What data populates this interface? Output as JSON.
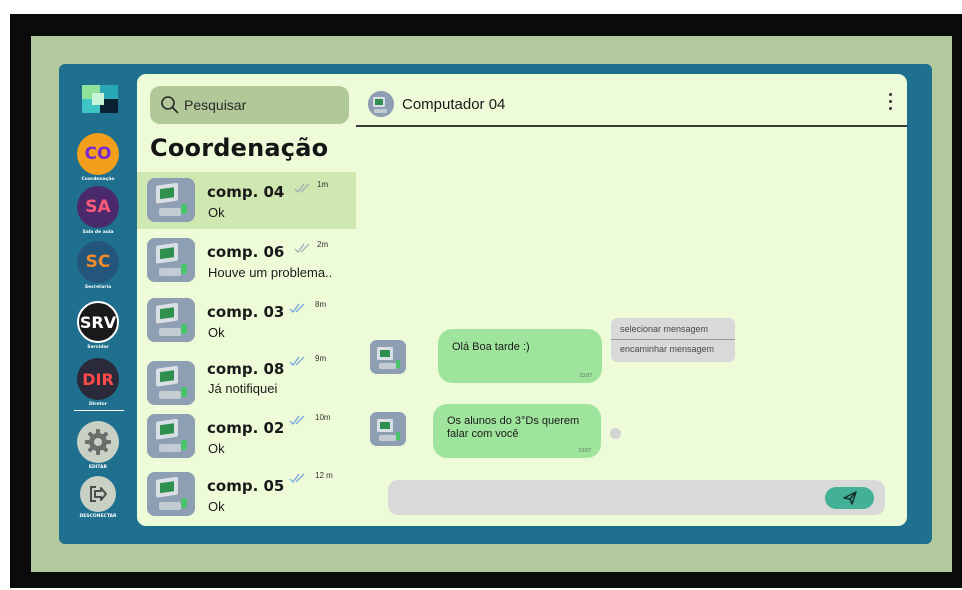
{
  "rail": {
    "items": [
      {
        "initials": "CO",
        "label": "Coordenação",
        "bg": "#f2a01c",
        "fg": "#7a2ad0"
      },
      {
        "initials": "SA",
        "label": "Sala de aula",
        "bg": "#4a2a6a",
        "fg": "#ff5a7a"
      },
      {
        "initials": "SC",
        "label": "Secretaria",
        "bg": "#24557a",
        "fg": "#f08a2a"
      },
      {
        "initials": "SRV",
        "label": "Servidor",
        "bg": "#1a1a1a",
        "fg": "#ffffff"
      },
      {
        "initials": "DIR",
        "label": "Diretor",
        "bg": "#2a2a3a",
        "fg": "#ff4a4a"
      }
    ],
    "edit_label": "EDITAR",
    "logout_label": "DESCONECTAR"
  },
  "search": {
    "placeholder": "Pesquisar"
  },
  "list": {
    "title": "Coordenação",
    "contacts": [
      {
        "name": "comp. 04",
        "last": "Ok",
        "time": "1m"
      },
      {
        "name": "comp. 06",
        "last": "Houve um problema..",
        "time": "2m"
      },
      {
        "name": "comp. 03",
        "last": "Ok",
        "time": "8m"
      },
      {
        "name": "comp. 08",
        "last": "Já notifiquei",
        "time": "9m"
      },
      {
        "name": "comp. 02",
        "last": "Ok",
        "time": "10m"
      },
      {
        "name": "comp. 05",
        "last": "Ok",
        "time": "12 m"
      }
    ]
  },
  "chat": {
    "title": "Computador 04",
    "messages": [
      {
        "text": "Olá Boa tarde :)",
        "time": "13:07"
      },
      {
        "text": "Os alunos do 3°Ds querem falar com você",
        "time": "13:07"
      }
    ],
    "context_menu": [
      "selecionar mensagem",
      "encaminhar mensagem"
    ],
    "input_placeholder": ""
  },
  "colors": {
    "accent": "#43b197",
    "bubble": "#9fe49c",
    "panel": "#eefbd8",
    "app_bg": "#1f6f8e",
    "outer_bg": "#b2c99e",
    "active_row": "#cfe7b0"
  },
  "icons": [
    "search-icon",
    "double-check-icon",
    "kebab-menu-icon",
    "gear-icon",
    "logout-icon",
    "send-icon",
    "computer-avatar-icon"
  ]
}
